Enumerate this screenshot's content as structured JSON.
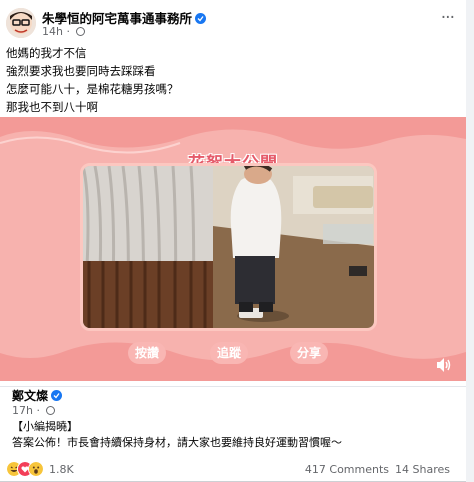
{
  "post": {
    "author": "朱學恒的阿宅萬事通事務所",
    "time": "14h",
    "more": "···",
    "lines": [
      "他媽的我才不信",
      "強烈要求我也要同時去踩踩看",
      "怎麼可能八十，是棉花糖男孩嗎？",
      "那我也不到八十啊"
    ]
  },
  "media": {
    "headline": "花絮大公開",
    "buttons": [
      "按讚",
      "追蹤",
      "分享"
    ]
  },
  "shared": {
    "author": "鄭文燦",
    "time": "17h",
    "lines": [
      "【小編揭曉】",
      "答案公佈！市長會持續保持身材，請大家也要維持良好運動習慣喔～"
    ]
  },
  "footer": {
    "reaction_count": "1.8K",
    "comments": "417 Comments",
    "shares": "14 Shares"
  },
  "colors": {
    "accent": "#1877f2",
    "media_pink": "#f5a9a5",
    "headline": "#e55b6a"
  }
}
